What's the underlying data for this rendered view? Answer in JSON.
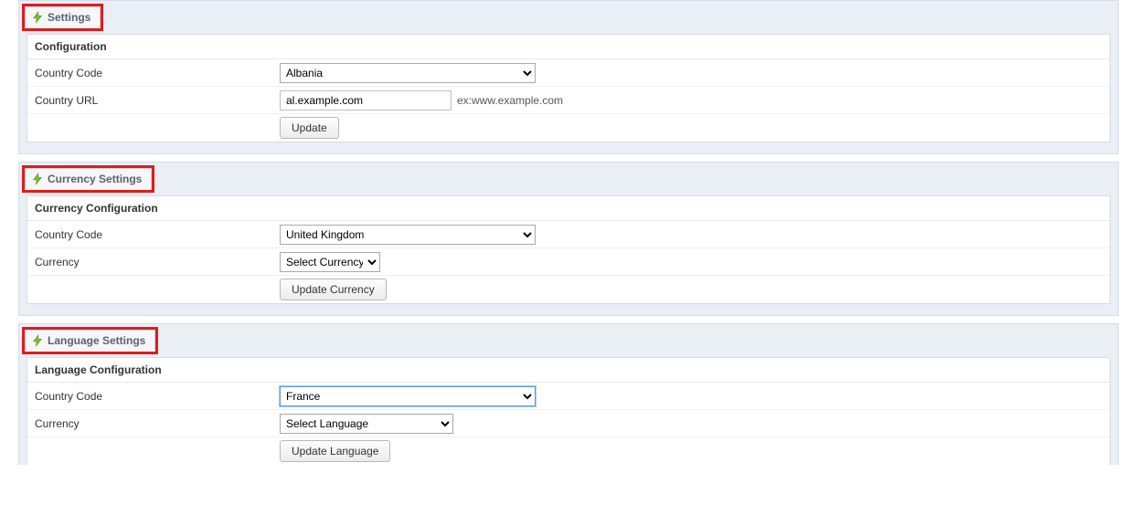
{
  "panels": {
    "settings": {
      "title": "Settings",
      "section_title": "Configuration",
      "row1_label": "Country Code",
      "row1_value": "Albania",
      "row2_label": "Country URL",
      "row2_value": "al.example.com",
      "row2_hint": "ex:www.example.com",
      "button": "Update"
    },
    "currency": {
      "title": "Currency Settings",
      "section_title": "Currency Configuration",
      "row1_label": "Country Code",
      "row1_value": "United Kingdom",
      "row2_label": "Currency",
      "row2_value": "Select Currency",
      "button": "Update Currency"
    },
    "language": {
      "title": "Language Settings",
      "section_title": "Language Configuration",
      "row1_label": "Country Code",
      "row1_value": "France",
      "row2_label": "Currency",
      "row2_value": "Select Language",
      "button": "Update Language"
    }
  }
}
